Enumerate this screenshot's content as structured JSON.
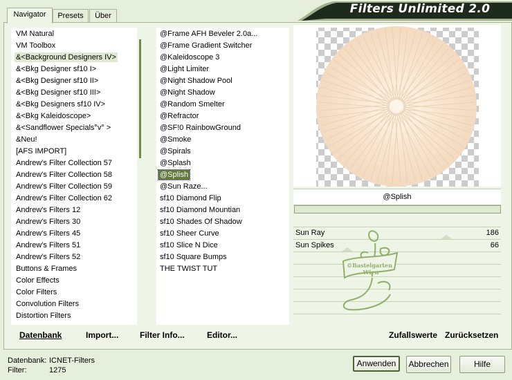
{
  "window": {
    "title": "Filters Unlimited 2.0"
  },
  "tabs": [
    "Navigator",
    "Presets",
    "Über"
  ],
  "categories": [
    "VM Natural",
    "VM Toolbox",
    "&<Background Designers IV>",
    "&<Bkg Designer sf10 I>",
    "&<Bkg Designer sf10 II>",
    "&<Bkg Designer sf10 III>",
    "&<Bkg Designers sf10 IV>",
    "&<Bkg Kaleidoscope>",
    "&<Sandflower Specials°v° >",
    "&Neu!",
    "[AFS IMPORT]",
    "Andrew's Filter Collection 57",
    "Andrew's Filter Collection 58",
    "Andrew's Filter Collection 59",
    "Andrew's Filter Collection 62",
    "Andrew's Filters 12",
    "Andrew's Filters 30",
    "Andrew's Filters 45",
    "Andrew's Filters 51",
    "Andrew's Filters 52",
    "Buttons & Frames",
    "Color Effects",
    "Color Filters",
    "Convolution Filters",
    "Distortion Filters"
  ],
  "filters": [
    "@Frame AFH Beveler 2.0a...",
    "@Frame Gradient Switcher",
    "@Kaleidoscope 3",
    "@Light Limiter",
    "@Night Shadow Pool",
    "@Night Shadow",
    "@Random Smelter",
    "@Refractor",
    "@SF!0 RainbowGround",
    "@Smoke",
    "@Spirals",
    "@Splash",
    "@Splish",
    "@Sun Raze...",
    "sf10 Diamond Flip",
    "sf10 Diamond Mountian",
    "sf10 Shades Of Shadow",
    "sf10 Sheer Curve",
    "sf10 Slice N Dice",
    "sf10 Square Bumps",
    "THE TWIST TUT"
  ],
  "selected_category_index": 2,
  "selected_filter_index": 12,
  "preview": {
    "filter_name": "@Splish",
    "watermark_text": [
      "©Bastelgarten",
      "Wien"
    ]
  },
  "params": [
    {
      "label": "Sun Ray",
      "value": "186"
    },
    {
      "label": "Sun Spikes",
      "value": "66"
    }
  ],
  "bottom_buttons": {
    "database": "Datenbank",
    "import": "Import...",
    "filter_info": "Filter Info...",
    "editor": "Editor...",
    "randomize": "Zufallswerte",
    "reset": "Zurücksetzen"
  },
  "status": {
    "db_label": "Datenbank:",
    "db_value": "ICNET-Filters",
    "filter_label": "Filter:",
    "filter_value": "1275"
  },
  "dialog_buttons": {
    "apply": "Anwenden",
    "cancel": "Abbrechen",
    "help": "Hilfe"
  },
  "colors": {
    "accent": "#627a3c",
    "banner": "#1d2a1d",
    "background": "#e6eedc"
  }
}
